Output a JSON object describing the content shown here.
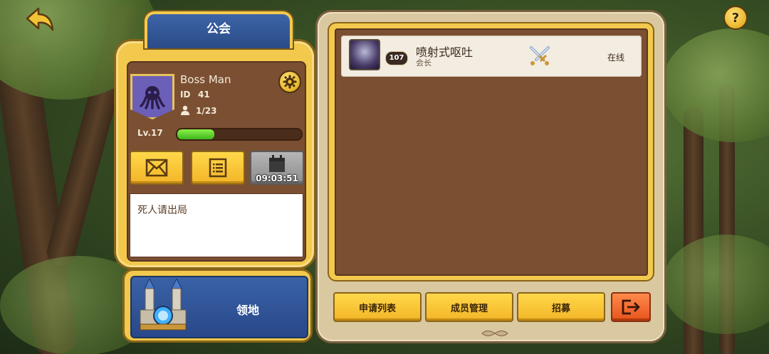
{
  "header": {
    "title": "公会",
    "help_label": "?"
  },
  "guild": {
    "name": "Boss Man",
    "id_label": "ID",
    "id": "41",
    "member_count": "1/23",
    "level_label": "Lv.17",
    "xp_progress": 0.3,
    "calendar_timer": "09:03:51",
    "notice": "死人请出局"
  },
  "territory": {
    "label": "领地"
  },
  "members": [
    {
      "level": "107",
      "name": "喷射式呕吐",
      "role": "会长",
      "status": "在线"
    }
  ],
  "buttons": {
    "apply_list": "申请列表",
    "member_manage": "成员管理",
    "recruit": "招募"
  },
  "colors": {
    "accent_gold": "#f2c94c",
    "panel_brown": "#7b4f32",
    "tab_blue": "#2a4b86",
    "exit_orange": "#e6531c",
    "xp_green": "#3fb51e"
  },
  "icons": [
    "back-arrow-icon",
    "help-icon",
    "octopus-emblem-icon",
    "member-icon",
    "gear-icon",
    "mail-icon",
    "list-icon",
    "calendar-icon",
    "castle-icon",
    "crossed-swords-icon",
    "exit-icon"
  ]
}
